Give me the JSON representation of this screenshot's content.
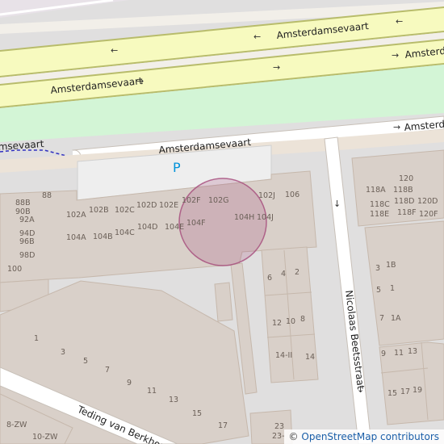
{
  "map": {
    "roads": {
      "amsterdamsevaart_top": "Amsterdamsevaart",
      "amsterdamsevaart_top_right": "Amsterdamsevaart",
      "amsterdamsevaart_mid": "Amsterdamsevaart",
      "amsterdamsevaart_low": "Amsterdamsevaart",
      "amsterdamsevaart_low_right": "Amsterdamsevaart",
      "amsterdamsevaart_left": "msevaart",
      "nicolaas_beetsstraat": "Nicolaas Beetsstraat",
      "teding": "Teding van Berkhout"
    },
    "arrows": {
      "left": "←",
      "right": "→",
      "down": "↓"
    },
    "parking_symbol": "P",
    "house_numbers": {
      "n88B": "88B",
      "n88": "88",
      "n90B": "90B",
      "n92A": "92A",
      "n94D": "94D",
      "n96B": "96B",
      "n98D": "98D",
      "n100": "100",
      "n102A": "102A",
      "n102B": "102B",
      "n102C": "102C",
      "n102D": "102D",
      "n102E": "102E",
      "n102F": "102F",
      "n102G": "102G",
      "n102J": "102J",
      "n106": "106",
      "n104A": "104A",
      "n104B": "104B",
      "n104C": "104C",
      "n104D": "104D",
      "n104E": "104E",
      "n104F": "104F",
      "n104H": "104H",
      "n104J": "104J",
      "n120": "120",
      "n118A": "118A",
      "n118B": "118B",
      "n118C": "118C",
      "n118D": "118D",
      "n118E": "118E",
      "n118F": "118F",
      "n120D": "120D",
      "n120F": "120F",
      "n3": "3",
      "n1B": "1B",
      "n5": "5",
      "n1": "1",
      "n7": "7",
      "n1A": "1A",
      "n9": "9",
      "n11": "11",
      "n13": "13",
      "n15": "15",
      "n17": "17",
      "n19": "19",
      "n6": "6",
      "n4": "4",
      "n2": "2",
      "n12": "12",
      "n10": "10",
      "n8": "8",
      "n14II": "14-II",
      "n14": "14",
      "s1": "1",
      "s3": "3",
      "s5": "5",
      "s7": "7",
      "s9": "9",
      "s11": "11",
      "s13": "13",
      "s15": "15",
      "s17": "17",
      "n8ZW": "8-ZW",
      "n10ZW": "10-ZW",
      "n23": "23",
      "n23b": "23-"
    },
    "colors": {
      "background": "#e0dfdf",
      "building": "#d9d0c9",
      "building_stroke": "#c6b8ac",
      "primary_road": "#f7fabf",
      "primary_road_casing": "#b8bc6b",
      "park": "#d3f5d6",
      "highlight": "#a54a7a"
    },
    "attribution": {
      "symbol": "©",
      "text": "OpenStreetMap contributors"
    }
  }
}
